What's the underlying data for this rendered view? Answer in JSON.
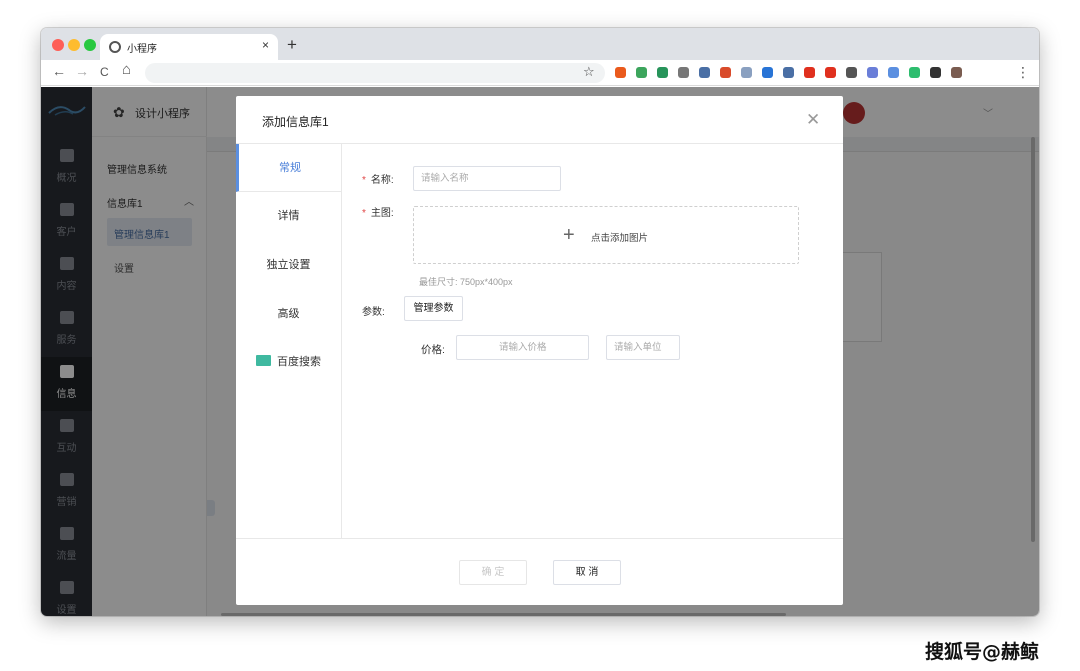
{
  "browser": {
    "tab_title": "小程序",
    "tab_close": "×",
    "new_tab": "+",
    "back": "←",
    "forward": "→",
    "reload": "C",
    "home": "⌂",
    "bookmark": "☆",
    "menu": "⋮",
    "extension_colors": [
      "#ea5a1c",
      "#3ca55c",
      "#27945a",
      "#777777",
      "#4a6fa5",
      "#d94b2b",
      "#8aa0c0",
      "#2874d6",
      "#4a6fa5",
      "#e0301e",
      "#e0301e",
      "#555555",
      "#6a7ed8",
      "#5b8fe0",
      "#2dbd6e",
      "#333333",
      "#7a5c50"
    ]
  },
  "sidebar": {
    "items": [
      {
        "label": "概况",
        "icon": "chart-icon"
      },
      {
        "label": "客户",
        "icon": "users-icon"
      },
      {
        "label": "内容",
        "icon": "document-icon"
      },
      {
        "label": "服务",
        "icon": "service-icon"
      },
      {
        "label": "信息",
        "icon": "message-icon"
      },
      {
        "label": "互动",
        "icon": "game-icon"
      },
      {
        "label": "营销",
        "icon": "tag-icon"
      },
      {
        "label": "流量",
        "icon": "megaphone-icon"
      },
      {
        "label": "设置",
        "icon": "gear-icon"
      }
    ],
    "active_index": 4
  },
  "subnav": {
    "header": "设计小程序",
    "section": "管理信息系统",
    "group": "信息库1",
    "group_arrow": "︿",
    "active_item": "管理信息库1",
    "item_settings": "设置"
  },
  "header": {
    "chevron": "﹀"
  },
  "modal": {
    "title": "添加信息库1",
    "close": "✕",
    "tabs": [
      "常规",
      "详情",
      "独立设置",
      "高级",
      "百度搜索"
    ],
    "active_tab": 0,
    "form": {
      "required_mark": "*",
      "name_label": "名称:",
      "name_placeholder": "请输入名称",
      "image_label": "主图:",
      "upload_plus": "+",
      "upload_text": "点击添加图片",
      "size_hint": "最佳尺寸: 750px*400px",
      "params_label": "参数:",
      "manage_params": "管理参数",
      "price_label": "价格:",
      "price_placeholder": "请输入价格",
      "unit_placeholder": "请输入单位"
    },
    "footer": {
      "confirm": "确 定",
      "cancel": "取 消"
    }
  },
  "watermark": "搜狐号@赫鲸"
}
